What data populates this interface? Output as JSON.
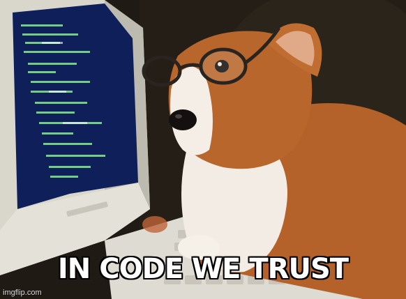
{
  "meme": {
    "caption": "IN CODE WE TRUST",
    "watermark": "imgflip.com"
  },
  "scene": {
    "subject": "corgi-with-glasses",
    "colors": {
      "background": "#1f1a14",
      "monitor_casing": "#dcdad0",
      "screen": "#0f1f5a",
      "code_text": "#7fe08a",
      "fur_orange": "#b5622a",
      "fur_white": "#f2ece4",
      "glasses": "#2a2420"
    }
  }
}
